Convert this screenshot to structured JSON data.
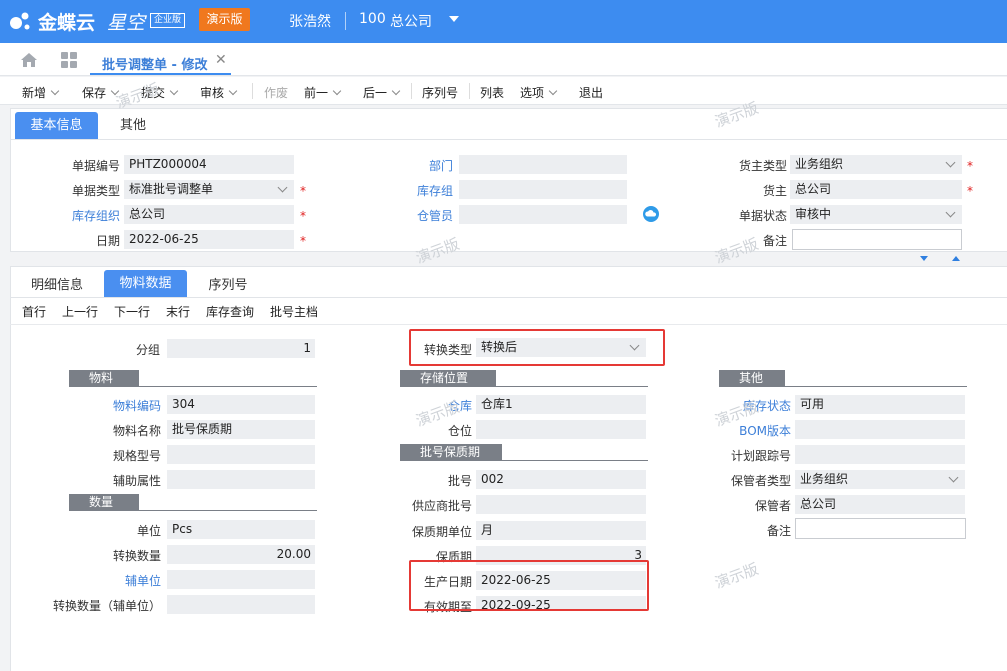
{
  "topbar": {
    "brand": "金蝶云",
    "brand_italic": "星空",
    "edition_badge": "企业版",
    "demo_button": "演示版",
    "user": "张浩然",
    "org_code": "100",
    "org_name": "总公司"
  },
  "tabs": {
    "active_label": "批号调整单 - 修改"
  },
  "toolbar": {
    "new": "新增",
    "save": "保存",
    "submit": "提交",
    "audit": "审核",
    "void": "作废",
    "prev": "前一",
    "next": "后一",
    "serial": "序列号",
    "list": "列表",
    "options": "选项",
    "exit": "退出"
  },
  "header_tabs": {
    "basic": "基本信息",
    "other": "其他"
  },
  "header": {
    "bill_no": {
      "label": "单据编号",
      "value": "PHTZ000004"
    },
    "bill_type": {
      "label": "单据类型",
      "value": "标准批号调整单"
    },
    "stock_org": {
      "label": "库存组织",
      "value": "总公司"
    },
    "date": {
      "label": "日期",
      "value": "2022-06-25"
    },
    "dept": {
      "label": "部门",
      "value": ""
    },
    "stock_group": {
      "label": "库存组",
      "value": ""
    },
    "stock_keeper": {
      "label": "仓管员",
      "value": ""
    },
    "owner_type": {
      "label": "货主类型",
      "value": "业务组织"
    },
    "owner": {
      "label": "货主",
      "value": "总公司"
    },
    "status": {
      "label": "单据状态",
      "value": "审核中"
    },
    "remark": {
      "label": "备注",
      "value": ""
    }
  },
  "detail_tabs": {
    "detail": "明细信息",
    "material": "物料数据",
    "serial": "序列号"
  },
  "row_nav": {
    "first": "首行",
    "prev": "上一行",
    "next": "下一行",
    "last": "末行",
    "stock_query": "库存查询",
    "lot_master": "批号主档"
  },
  "detail": {
    "group": {
      "label": "分组",
      "value": "1"
    },
    "convert_type": {
      "label": "转换类型",
      "value": "转换后"
    },
    "sections": {
      "material": "物料",
      "qty": "数量",
      "storage": "存储位置",
      "lot": "批号保质期",
      "other": "其他"
    },
    "mat_code": {
      "label": "物料编码",
      "value": "304"
    },
    "mat_name": {
      "label": "物料名称",
      "value": "批号保质期"
    },
    "spec": {
      "label": "规格型号",
      "value": ""
    },
    "aux_attr": {
      "label": "辅助属性",
      "value": ""
    },
    "unit": {
      "label": "单位",
      "value": "Pcs"
    },
    "conv_qty": {
      "label": "转换数量",
      "value": "20.00"
    },
    "aux_unit": {
      "label": "辅单位",
      "value": ""
    },
    "conv_qty_aux": {
      "label": "转换数量（辅单位）",
      "value": ""
    },
    "warehouse": {
      "label": "仓库",
      "value": "仓库1"
    },
    "location": {
      "label": "仓位",
      "value": ""
    },
    "lot_no": {
      "label": "批号",
      "value": "002"
    },
    "supplier_lot": {
      "label": "供应商批号",
      "value": ""
    },
    "shelf_unit": {
      "label": "保质期单位",
      "value": "月"
    },
    "shelf_life": {
      "label": "保质期",
      "value": "3"
    },
    "prod_date": {
      "label": "生产日期",
      "value": "2022-06-25"
    },
    "expiry_date": {
      "label": "有效期至",
      "value": "2022-09-25"
    },
    "stock_status": {
      "label": "库存状态",
      "value": "可用"
    },
    "bom_version": {
      "label": "BOM版本",
      "value": ""
    },
    "tracking_no": {
      "label": "计划跟踪号",
      "value": ""
    },
    "keeper_type": {
      "label": "保管者类型",
      "value": "业务组织"
    },
    "keeper": {
      "label": "保管者",
      "value": "总公司"
    },
    "remark": {
      "label": "备注",
      "value": ""
    }
  },
  "watermark": "演示版",
  "colors": {
    "primary": "#3d8cf0",
    "demo_button": "#f0781e",
    "highlight": "#e53935"
  }
}
